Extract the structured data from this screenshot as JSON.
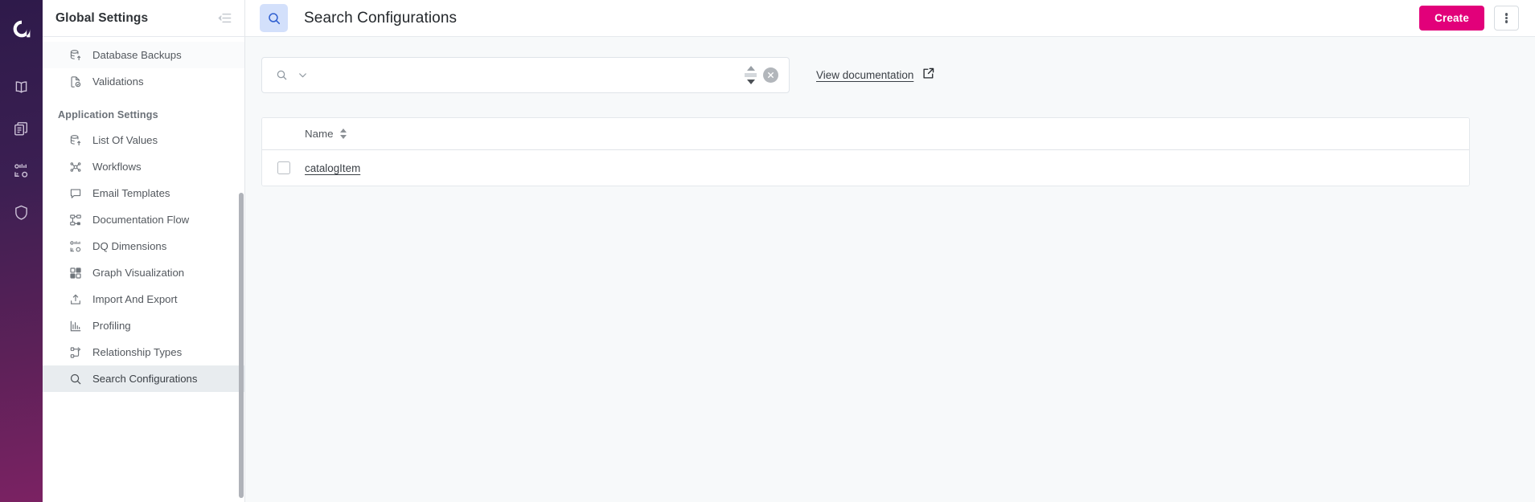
{
  "rail": {
    "logo": "anwendung-logo",
    "icons": [
      {
        "name": "book-icon",
        "label": "Glossary"
      },
      {
        "name": "catalog-icon",
        "label": "Catalog"
      },
      {
        "name": "data-quality-icon",
        "label": "Data Quality"
      },
      {
        "name": "shield-icon",
        "label": "Governance"
      }
    ]
  },
  "sidebar": {
    "title": "Global Settings",
    "collapse_icon": "collapse-panel-icon",
    "top_items": [
      {
        "label": "Database Backups",
        "icon": "database-upload-icon",
        "selected": false,
        "hovered": true
      },
      {
        "label": "Validations",
        "icon": "document-check-icon",
        "selected": false,
        "hovered": false
      }
    ],
    "section_label": "Application Settings",
    "items": [
      {
        "label": "List Of Values",
        "icon": "database-upload-icon",
        "selected": false
      },
      {
        "label": "Workflows",
        "icon": "workflow-nodes-icon",
        "selected": false
      },
      {
        "label": "Email Templates",
        "icon": "speech-bubble-icon",
        "selected": false
      },
      {
        "label": "Documentation Flow",
        "icon": "flow-chart-icon",
        "selected": false
      },
      {
        "label": "DQ Dimensions",
        "icon": "dq-dimensions-icon",
        "selected": false
      },
      {
        "label": "Graph Visualization",
        "icon": "grid-squares-icon",
        "selected": false
      },
      {
        "label": "Import And Export",
        "icon": "upload-box-icon",
        "selected": false
      },
      {
        "label": "Profiling",
        "icon": "bar-chart-icon",
        "selected": false
      },
      {
        "label": "Relationship Types",
        "icon": "relationship-icon",
        "selected": false
      },
      {
        "label": "Search Configurations",
        "icon": "magnifier-icon",
        "selected": true
      }
    ]
  },
  "topbar": {
    "page_icon": "search-magnifier-icon",
    "title": "Search Configurations",
    "create_label": "Create",
    "kebab_icon": "more-vertical-icon"
  },
  "filter": {
    "search_icon": "magnifier-icon",
    "caret_icon": "chevron-down-icon",
    "search_value": "",
    "search_placeholder": "",
    "spinner_icon": "number-stepper-icon",
    "clear_icon": "clear-circle-icon",
    "doc_link_label": "View documentation",
    "doc_link_icon": "external-link-icon"
  },
  "table": {
    "columns": [
      {
        "key": "select",
        "label": ""
      },
      {
        "key": "name",
        "label": "Name",
        "sortable": true,
        "sort_icon": "sort-arrows-icon"
      }
    ],
    "rows": [
      {
        "selected": false,
        "name": "catalogItem"
      }
    ]
  },
  "colors": {
    "brand_magenta": "#e2007a",
    "rail_gradient_start": "#2e1a4a",
    "rail_gradient_end": "#7b2263",
    "page_icon_bg": "#d3e0fb",
    "page_icon_fg": "#2f5fd0",
    "selected_nav_bg": "#e8ecef",
    "content_bg": "#f7f9fa"
  }
}
